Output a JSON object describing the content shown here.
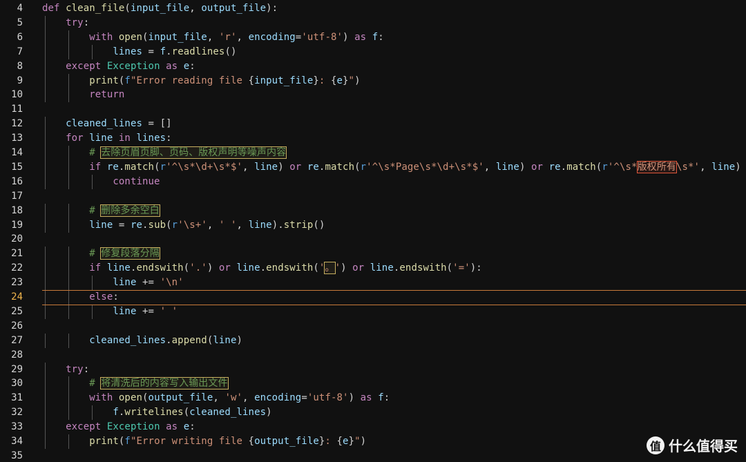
{
  "editor": {
    "current_line": 24,
    "lines": [
      {
        "n": "4",
        "t": "def clean_file(input_file, output_file):"
      },
      {
        "n": "5",
        "t": "    try:"
      },
      {
        "n": "6",
        "t": "        with open(input_file, 'r', encoding='utf-8') as f:"
      },
      {
        "n": "7",
        "t": "            lines = f.readlines()"
      },
      {
        "n": "8",
        "t": "    except Exception as e:"
      },
      {
        "n": "9",
        "t": "        print(f\"Error reading file {input_file}: {e}\")"
      },
      {
        "n": "10",
        "t": "        return"
      },
      {
        "n": "11",
        "t": ""
      },
      {
        "n": "12",
        "t": "    cleaned_lines = []"
      },
      {
        "n": "13",
        "t": "    for line in lines:"
      },
      {
        "n": "14",
        "t": "        # 去除页眉页脚、页码、版权声明等噪声内容"
      },
      {
        "n": "15",
        "t": "        if re.match(r'^\\s*\\d+\\s*$', line) or re.match(r'^\\s*Page\\s*\\d+\\s*$', line) or re.match(r'^\\s*版权所有\\s*', line) or"
      },
      {
        "n": "16",
        "t": "            continue"
      },
      {
        "n": "17",
        "t": ""
      },
      {
        "n": "18",
        "t": "        # 删除多余空白"
      },
      {
        "n": "19",
        "t": "        line = re.sub(r'\\s+', ' ', line).strip()"
      },
      {
        "n": "20",
        "t": ""
      },
      {
        "n": "21",
        "t": "        # 修复段落分隔"
      },
      {
        "n": "22",
        "t": "        if line.endswith('.') or line.endswith('。') or line.endswith('='):"
      },
      {
        "n": "23",
        "t": "            line += '\\n'"
      },
      {
        "n": "24",
        "t": "        else:"
      },
      {
        "n": "25",
        "t": "            line += ' '"
      },
      {
        "n": "26",
        "t": ""
      },
      {
        "n": "27",
        "t": "        cleaned_lines.append(line)"
      },
      {
        "n": "28",
        "t": ""
      },
      {
        "n": "29",
        "t": "    try:"
      },
      {
        "n": "30",
        "t": "        # 将清洗后的内容写入输出文件"
      },
      {
        "n": "31",
        "t": "        with open(output_file, 'w', encoding='utf-8') as f:"
      },
      {
        "n": "32",
        "t": "            f.writelines(cleaned_lines)"
      },
      {
        "n": "33",
        "t": "    except Exception as e:"
      },
      {
        "n": "34",
        "t": "        print(f\"Error writing file {output_file}: {e}\")"
      },
      {
        "n": "35",
        "t": ""
      }
    ]
  },
  "watermark": {
    "text": "什么值得买",
    "icon": "值"
  },
  "colors": {
    "background": "#111111",
    "keyword": "#c586c0",
    "function": "#dcdcaa",
    "variable": "#9cdcfe",
    "string": "#ce9178",
    "class": "#4ec9b0",
    "comment": "#6a9955",
    "current_line_border": "#c87a3a"
  }
}
